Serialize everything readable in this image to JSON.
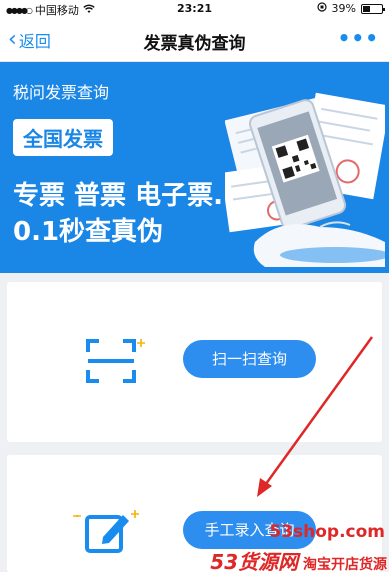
{
  "status_bar": {
    "carrier": "中国移动",
    "time": "23:21",
    "battery": "39%",
    "battery_level": 0.39
  },
  "nav": {
    "back_label": "返回",
    "title": "发票真伪查询",
    "more_icon": "more-dots-icon"
  },
  "banner": {
    "subtitle": "税问发票查询",
    "badge": "全国发票",
    "headline_line1": "专票 普票 电子票...",
    "headline_line2": "0.1秒查真伪"
  },
  "actions": {
    "scan_label": "扫一扫查询",
    "manual_label": "手工录入查询"
  },
  "watermark": {
    "line1": "53shop.com",
    "brand": "53货源网",
    "line2": "淘宝开店货源"
  },
  "colors": {
    "accent": "#1a8cf0",
    "banner": "#1a86e6",
    "button": "#2d8ef0",
    "annotation_arrow": "#e02727"
  }
}
